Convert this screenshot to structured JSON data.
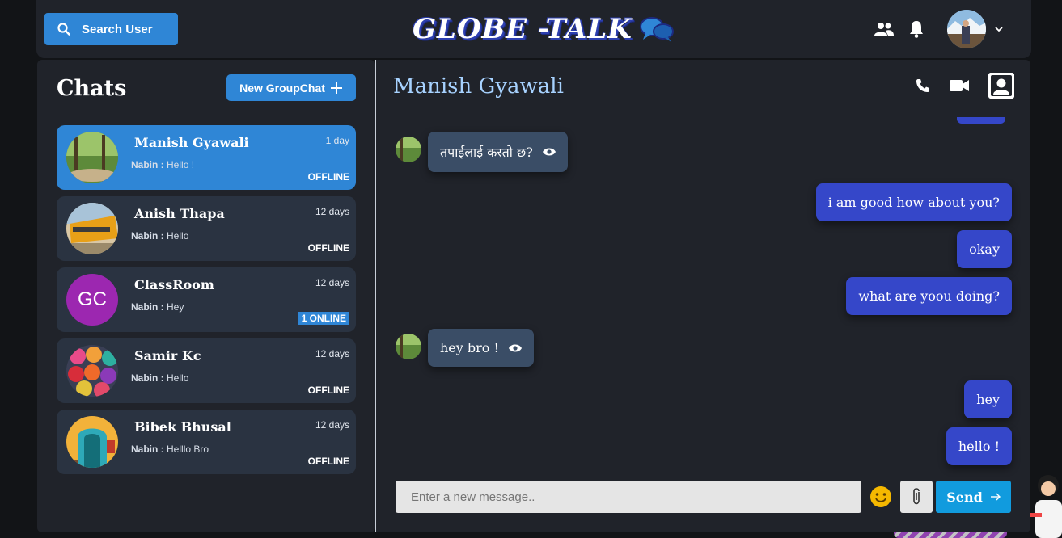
{
  "header": {
    "search_label": "Search User",
    "logo_text": "GLOBE -TALK"
  },
  "sidebar": {
    "title": "Chats",
    "new_group_label": "New GroupChat",
    "chats": [
      {
        "name": "Manish Gyawali",
        "time": "1 day",
        "sender": "Nabin :",
        "preview": "Hello !",
        "status": "OFFLINE"
      },
      {
        "name": "Anish Thapa",
        "time": "12 days",
        "sender": "Nabin :",
        "preview": "Hello",
        "status": "OFFLINE"
      },
      {
        "name": "ClassRoom",
        "time": "12 days",
        "sender": "Nabin :",
        "preview": "Hey",
        "status": "1 ONLINE",
        "initials": "GC"
      },
      {
        "name": "Samir Kc",
        "time": "12 days",
        "sender": "Nabin :",
        "preview": "Hello",
        "status": "OFFLINE"
      },
      {
        "name": "Bibek Bhusal",
        "time": "12 days",
        "sender": "Nabin :",
        "preview": "Helllo Bro",
        "status": "OFFLINE"
      }
    ]
  },
  "chat": {
    "contact_name": "Manish Gyawali",
    "messages": [
      {
        "direction": "in",
        "text": "तपाईलाई कस्तो छ?"
      },
      {
        "direction": "out",
        "text": "i am good how about you?"
      },
      {
        "direction": "out",
        "text": "okay"
      },
      {
        "direction": "out",
        "text": "what are yoou doing?"
      },
      {
        "direction": "in",
        "text": "hey bro !"
      },
      {
        "direction": "out",
        "text": "hey"
      },
      {
        "direction": "out",
        "text": "hello !"
      }
    ],
    "input_placeholder": "Enter a new message..",
    "send_label": "Send"
  },
  "colors": {
    "accent": "#2f86d6",
    "outgoing_bubble": "#3547c9",
    "incoming_bubble": "#3a4d66",
    "contact_name": "#a7d2ff"
  }
}
